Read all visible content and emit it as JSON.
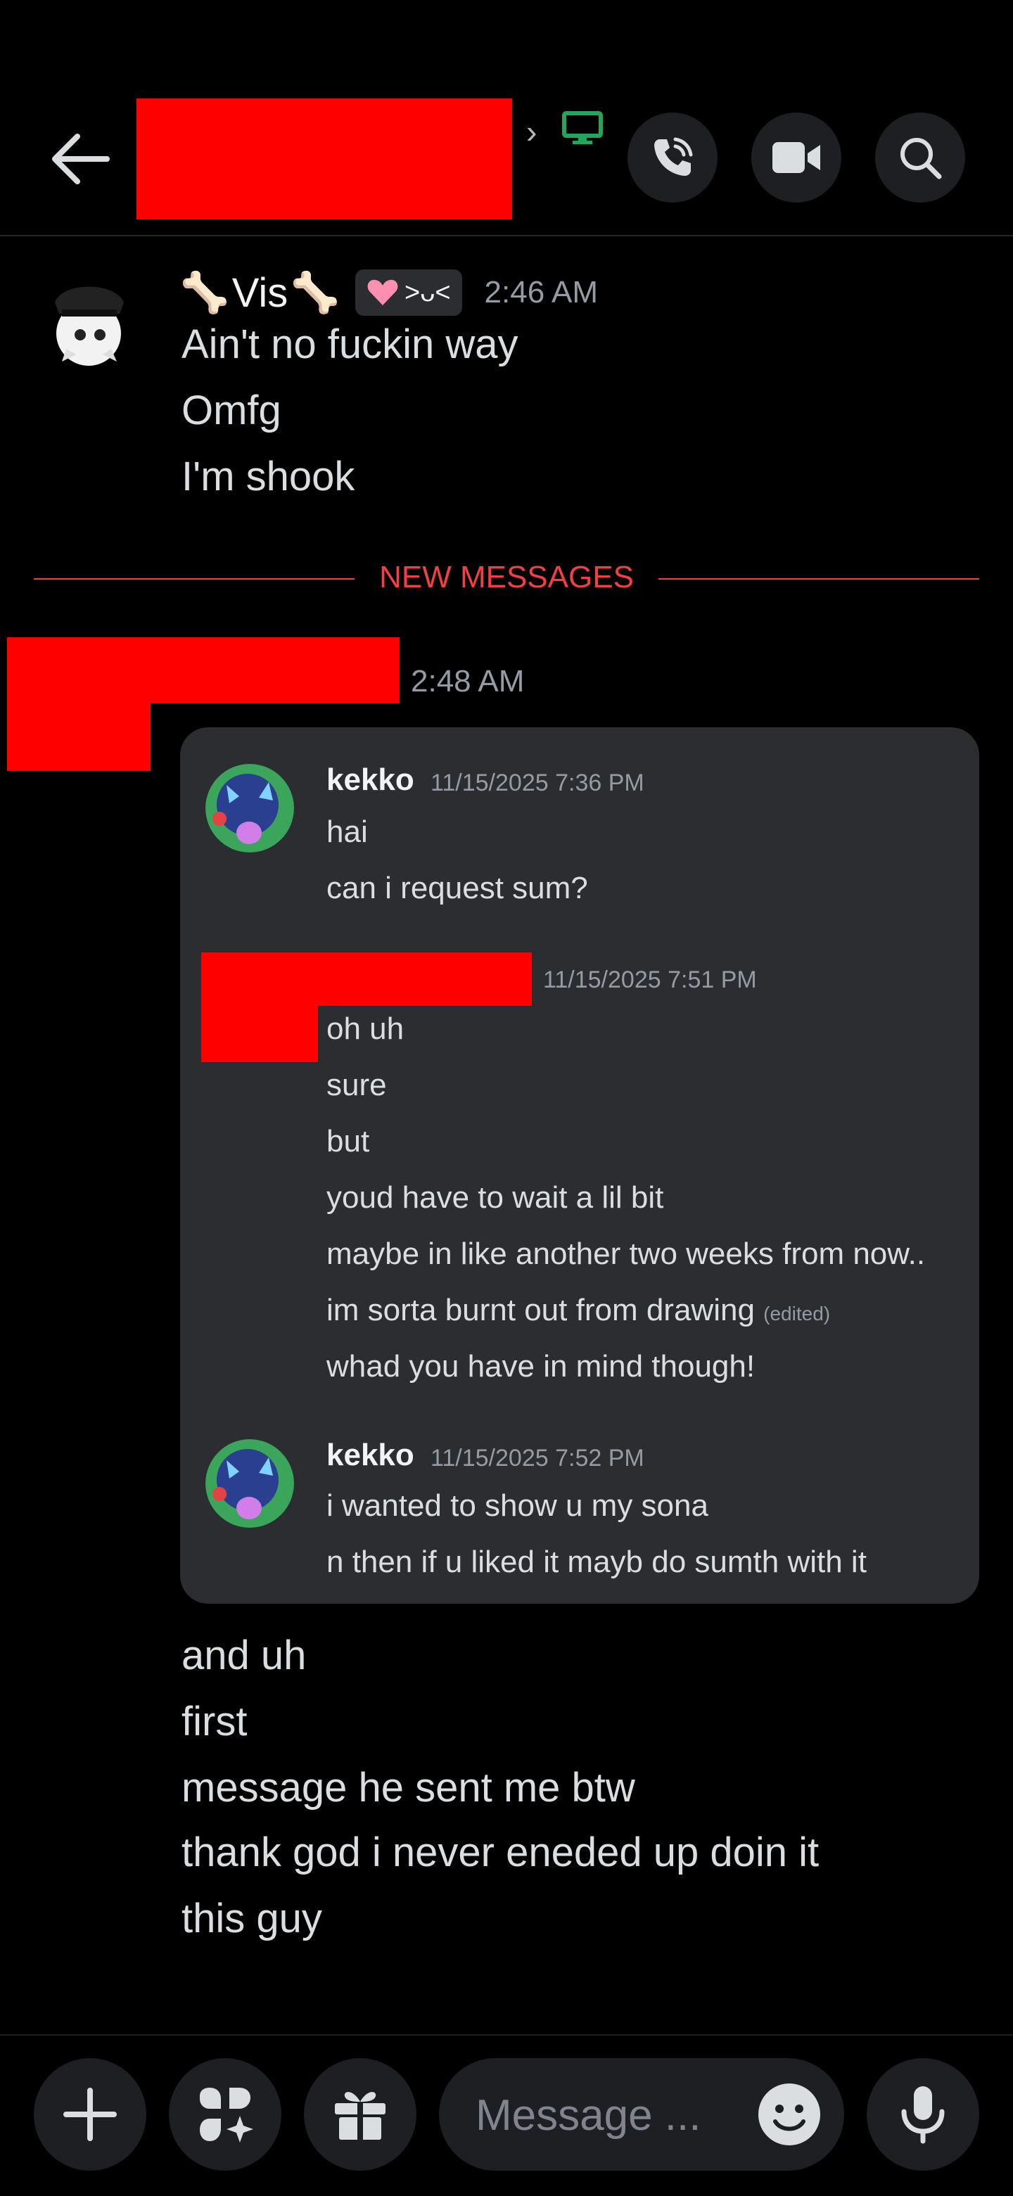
{
  "header": {
    "back_icon": "arrow-left-icon",
    "channel_status_icon": "monitor-icon",
    "call_icon": "phone-call-icon",
    "video_icon": "video-camera-icon",
    "search_icon": "search-icon",
    "status_color": "#23a55a"
  },
  "message1": {
    "author": "Vis",
    "author_emoji": "🦴",
    "tag": ">ᴗ<",
    "time": "2:46 AM",
    "lines": [
      "Ain't no fuckin way",
      "Omfg",
      "I'm shook"
    ]
  },
  "divider": {
    "label": "NEW MESSAGES",
    "color": "#f23f43"
  },
  "message2": {
    "time": "2:48 AM",
    "forwarded": {
      "groups": [
        {
          "author": "kekko",
          "time": "11/15/2025 7:36 PM",
          "lines": [
            "hai",
            "can i request sum?"
          ]
        },
        {
          "author": "",
          "time": "11/15/2025 7:51 PM",
          "lines": [
            "oh uh",
            "sure",
            "but",
            "youd have to wait a lil bit",
            "maybe in like another two weeks from now..",
            "im sorta burnt out from drawing",
            "whad you have in mind though!"
          ],
          "edited": "(edited)"
        },
        {
          "author": "kekko",
          "time": "11/15/2025 7:52 PM",
          "lines": [
            "i wanted to show u my sona",
            "n then if u liked it mayb do sumth with it"
          ]
        }
      ]
    },
    "lines": [
      "and uh",
      "first",
      "message he sent me btw",
      "thank god i never eneded up doin it",
      "this guy"
    ]
  },
  "composer": {
    "placeholder": "Message ...",
    "plus_icon": "plus-icon",
    "apps_icon": "apps-sparkle-icon",
    "gift_icon": "gift-icon",
    "emoji_icon": "emoji-smile-icon",
    "mic_icon": "microphone-icon"
  }
}
